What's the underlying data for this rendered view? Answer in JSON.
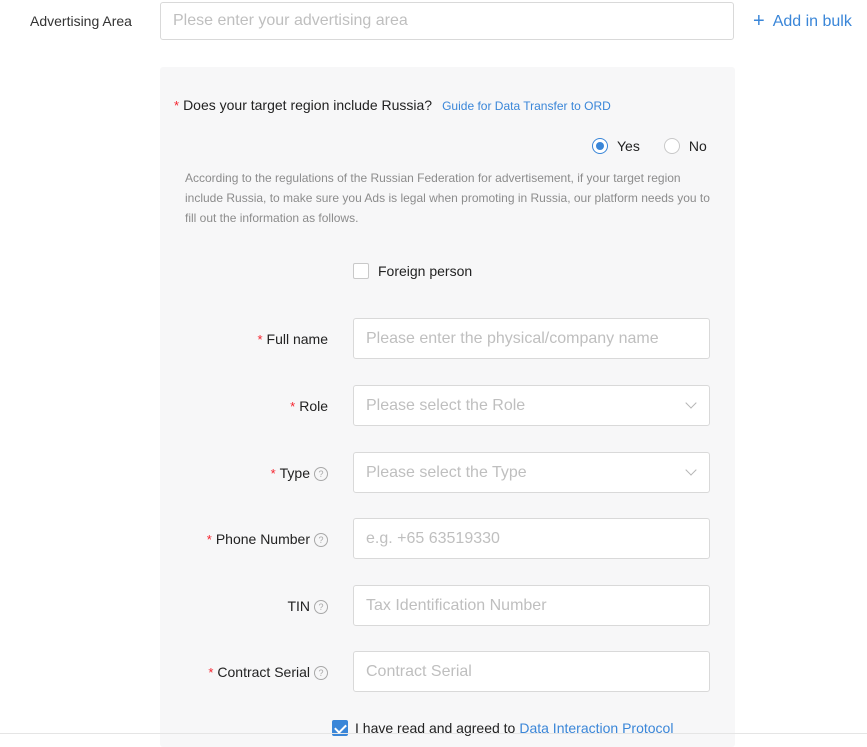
{
  "advertising": {
    "label": "Advertising Area",
    "placeholder": "Plese enter your advertising area",
    "add_bulk": "Add in bulk"
  },
  "russia": {
    "question": "Does your target region include Russia?",
    "guide_link": "Guide for Data Transfer to ORD",
    "options": [
      "Yes",
      "No"
    ],
    "selected": "Yes",
    "notice": "According to the regulations of the Russian Federation for advertisement, if your target region include Russia, to make sure you Ads is legal when promoting in Russia, our platform needs you to fill out the information as follows."
  },
  "foreign_person": {
    "label": "Foreign person",
    "checked": false
  },
  "fields": {
    "full_name": {
      "label": "Full name",
      "required": true,
      "placeholder": "Please enter the physical/company name"
    },
    "role": {
      "label": "Role",
      "required": true,
      "placeholder": "Please select the Role"
    },
    "type": {
      "label": "Type",
      "required": true,
      "placeholder": "Please select the Type"
    },
    "phone": {
      "label": "Phone Number",
      "required": true,
      "placeholder": "e.g. +65 63519330"
    },
    "tin": {
      "label": "TIN",
      "required": false,
      "placeholder": "Tax Identification Number"
    },
    "contract_serial": {
      "label": "Contract Serial",
      "required": true,
      "placeholder": "Contract Serial"
    }
  },
  "agreement": {
    "text": "I have read and agreed to",
    "link": "Data Interaction Protocol",
    "checked": true
  },
  "symbols": {
    "required": "*",
    "help": "?",
    "plus": "+"
  },
  "colors": {
    "accent": "#3a86d8",
    "required": "#f5222d",
    "panel_bg": "#f7f7f8"
  },
  "icons": [
    "plus-icon",
    "help-circle-icon",
    "chevron-down-icon",
    "checkmark-icon"
  ]
}
